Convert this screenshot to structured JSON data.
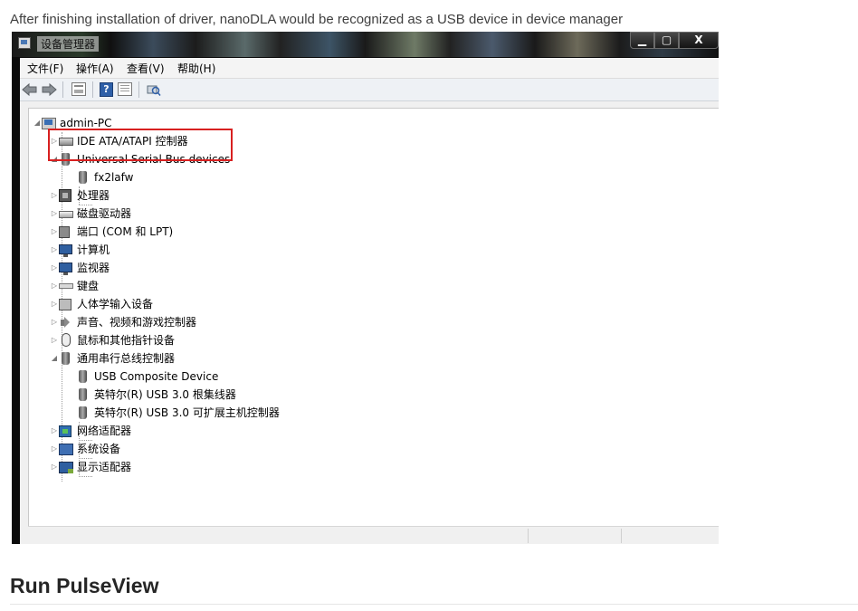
{
  "caption": "After finishing installation of driver, nanoDLA would be recognized as a USB device in device manager",
  "window": {
    "title": "设备管理器",
    "controls": {
      "minimize": "▁",
      "maximize": "▢",
      "close": "X"
    }
  },
  "menu": [
    "文件(F)",
    "操作(A)",
    "查看(V)",
    "帮助(H)"
  ],
  "toolbar": {
    "buttons": [
      "back-icon",
      "forward-icon",
      "properties-sheet-icon",
      "help-icon",
      "view-grid-icon",
      "scan-hardware-icon"
    ],
    "help_glyph": "?"
  },
  "tree": {
    "root": "admin-PC",
    "nodes": [
      {
        "label": "IDE ATA/ATAPI 控制器",
        "expander": "▷",
        "icon": "drive-icon"
      },
      {
        "label": "Universal Serial Bus devices",
        "expander": "◢",
        "icon": "usb-icon",
        "children": [
          {
            "label": "fx2lafw",
            "icon": "usb-icon"
          }
        ]
      },
      {
        "label": "处理器",
        "expander": "▷",
        "icon": "cpu-icon"
      },
      {
        "label": "磁盘驱动器",
        "expander": "▷",
        "icon": "disk-icon"
      },
      {
        "label": "端口 (COM 和 LPT)",
        "expander": "▷",
        "icon": "port-icon"
      },
      {
        "label": "计算机",
        "expander": "▷",
        "icon": "computer-icon"
      },
      {
        "label": "监视器",
        "expander": "▷",
        "icon": "monitor-icon"
      },
      {
        "label": "键盘",
        "expander": "▷",
        "icon": "keyboard-icon"
      },
      {
        "label": "人体学输入设备",
        "expander": "▷",
        "icon": "hid-icon"
      },
      {
        "label": "声音、视频和游戏控制器",
        "expander": "▷",
        "icon": "sound-icon"
      },
      {
        "label": "鼠标和其他指针设备",
        "expander": "▷",
        "icon": "mouse-icon"
      },
      {
        "label": "通用串行总线控制器",
        "expander": "◢",
        "icon": "usb-icon",
        "children": [
          {
            "label": "USB Composite Device",
            "icon": "usb-icon"
          },
          {
            "label": "英特尔(R) USB 3.0 根集线器",
            "icon": "usb-icon"
          },
          {
            "label": "英特尔(R) USB 3.0 可扩展主机控制器",
            "icon": "usb-icon"
          }
        ]
      },
      {
        "label": "网络适配器",
        "expander": "▷",
        "icon": "network-icon"
      },
      {
        "label": "系统设备",
        "expander": "▷",
        "icon": "system-icon"
      },
      {
        "label": "显示适配器",
        "expander": "▷",
        "icon": "display-icon"
      }
    ],
    "root_expander": "◢"
  },
  "highlight_color": "#d82020",
  "heading": "Run PulseView"
}
